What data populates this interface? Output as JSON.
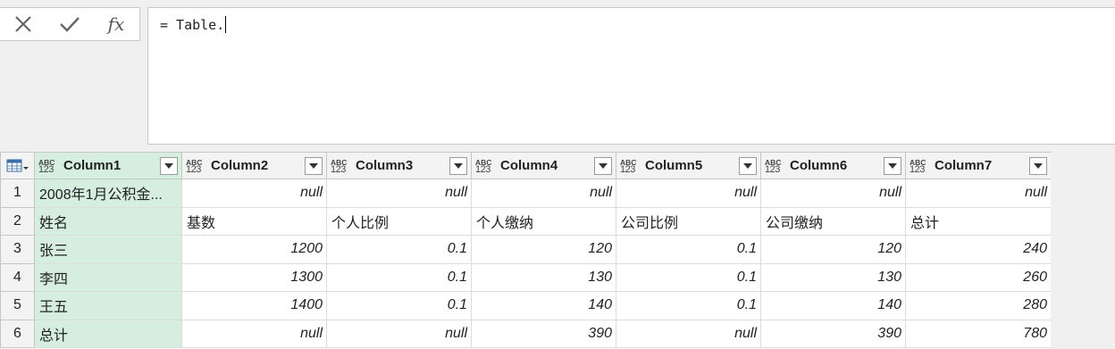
{
  "formula_bar": {
    "cancel_icon": "close-x-icon",
    "commit_icon": "checkmark-icon",
    "fx_label": "fx",
    "formula": "= Table."
  },
  "grid": {
    "type_icon_top": "ABC",
    "type_icon_bottom": "123",
    "columns": [
      "Column1",
      "Column2",
      "Column3",
      "Column4",
      "Column5",
      "Column6",
      "Column7"
    ],
    "rows": [
      {
        "num": "1",
        "cells": [
          "2008年1月公积金...",
          "null",
          "null",
          "null",
          "null",
          "null",
          "null"
        ]
      },
      {
        "num": "2",
        "cells": [
          "姓名",
          "基数",
          "个人比例",
          "个人缴纳",
          "公司比例",
          "公司缴纳",
          "总计"
        ]
      },
      {
        "num": "3",
        "cells": [
          "张三",
          "1200",
          "0.1",
          "120",
          "0.1",
          "120",
          "240"
        ]
      },
      {
        "num": "4",
        "cells": [
          "李四",
          "1300",
          "0.1",
          "130",
          "0.1",
          "130",
          "260"
        ]
      },
      {
        "num": "5",
        "cells": [
          "王五",
          "1400",
          "0.1",
          "140",
          "0.1",
          "140",
          "280"
        ]
      },
      {
        "num": "6",
        "cells": [
          "总计",
          "null",
          "null",
          "390",
          "null",
          "390",
          "780"
        ]
      }
    ],
    "colors": {
      "selected_column": "#d5eee0",
      "header": "#f3f3f3"
    }
  }
}
